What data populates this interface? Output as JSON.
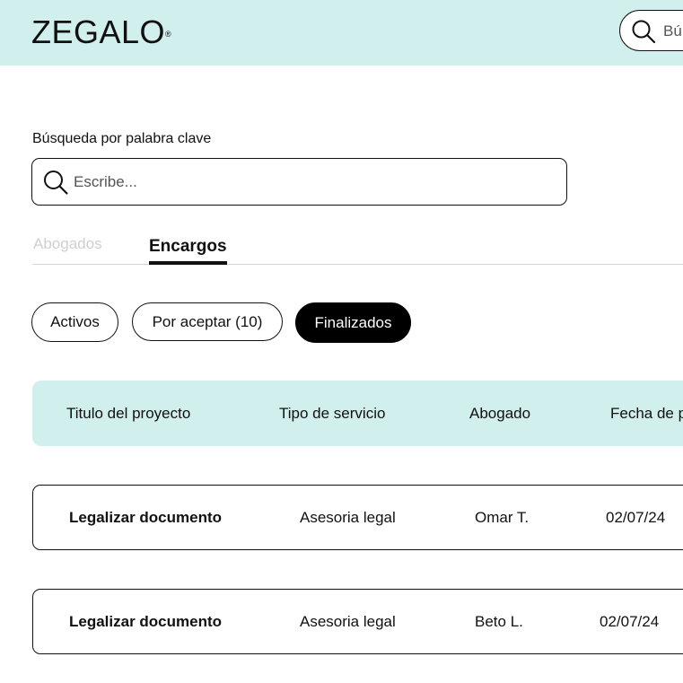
{
  "header": {
    "logo": "ZEGALO",
    "logo_mark": "®",
    "search_placeholder": "Bú",
    "search_icon": "search-icon"
  },
  "keyword_search": {
    "label": "Búsqueda por palabra clave",
    "placeholder": "Escribe...",
    "value": "",
    "icon": "search-icon"
  },
  "tabs": [
    {
      "label": "Abogados",
      "active": false
    },
    {
      "label": "Encargos",
      "active": true
    }
  ],
  "filters": [
    {
      "label": "Activos",
      "selected": false
    },
    {
      "label": "Por aceptar (10)",
      "selected": false
    },
    {
      "label": "Finalizados",
      "selected": true
    }
  ],
  "table": {
    "columns": [
      "Titulo del proyecto",
      "Tipo de servicio",
      "Abogado",
      "Fecha de p"
    ],
    "rows": [
      {
        "title": "Legalizar documento",
        "service": "Asesoria legal",
        "lawyer": "Omar T.",
        "date": "02/07/24"
      },
      {
        "title": "Legalizar documento",
        "service": "Asesoria legal",
        "lawyer": "Beto L.",
        "date": "02/07/24"
      }
    ]
  },
  "colors": {
    "accent_bg": "#d1efec",
    "selected_pill": "#000000",
    "inactive_tab": "#cfcfcf"
  }
}
